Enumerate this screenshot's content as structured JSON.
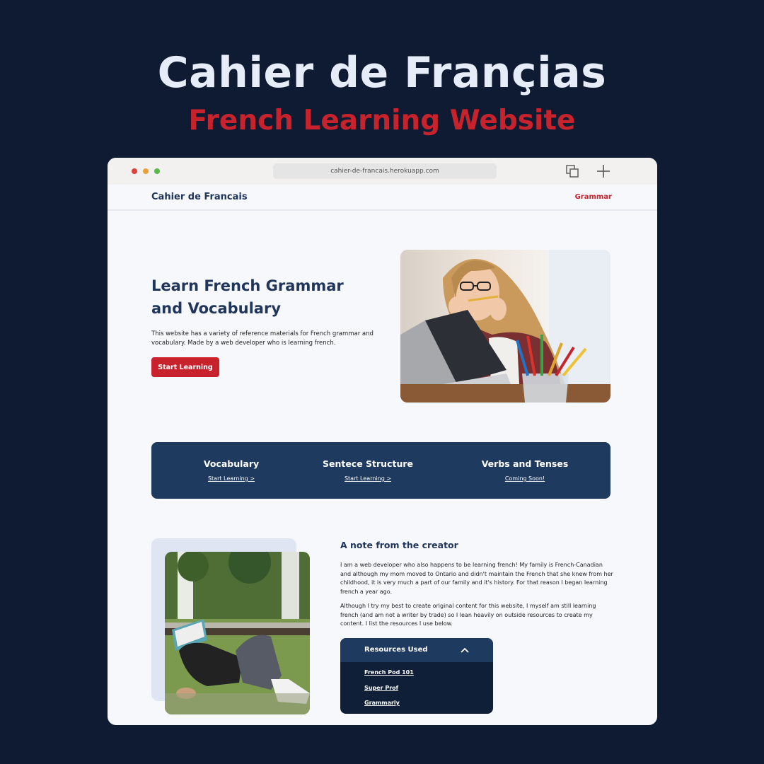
{
  "poster": {
    "title": "Cahier de Françias",
    "subtitle": "French Learning Website"
  },
  "browser": {
    "url": "cahier-de-francais.herokuapp.com"
  },
  "site": {
    "brand": "Cahier de Francais",
    "nav": [
      "Grammar"
    ]
  },
  "hero": {
    "title_line1": "Learn French Grammar",
    "title_line2": "and Vocabulary",
    "description": "This website has a variety of reference materials for French grammar and vocabulary. Made by a web developer who is learning french.",
    "button": "Start Learning"
  },
  "categories": [
    {
      "title": "Vocabulary",
      "link": "Start Learning >"
    },
    {
      "title": "Sentece Structure",
      "link": "Start Learning >"
    },
    {
      "title": "Verbs and Tenses",
      "link": "Coming Soon!"
    }
  ],
  "note": {
    "title": "A note from the creator",
    "p1": "I am a web developer who also happens to be learning french! My family is French-Canadian and although my mom moved to Ontario and didn't maintain the French that she knew from her childhood, it is very much a part of our family and it's history. For that reason I began learning french a year ago.",
    "p2": "Although I try my best to create original content for this website, I myself am still learning french (and am not a writer by trade) so I lean heavily on outside resources to create my content. I list the resources I use below."
  },
  "resources": {
    "title": "Resources Used",
    "items": [
      "French Pod 101",
      "Super Prof",
      "Grammarly"
    ]
  },
  "colors": {
    "background": "#0f1b32",
    "accent_red": "#c8232c",
    "navy": "#1f3a5f",
    "dark_navy": "#0f1f38"
  }
}
